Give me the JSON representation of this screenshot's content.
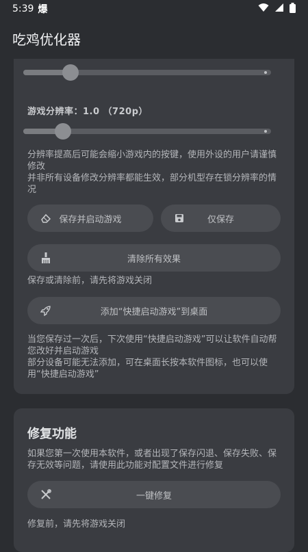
{
  "status_bar": {
    "time": "5:39",
    "notif_glyph": "爆",
    "icons": [
      "wifi-icon",
      "signal-icon",
      "battery-icon"
    ]
  },
  "app_bar": {
    "title": "吃鸡优化器"
  },
  "settings": {
    "slider1_level": 0.19,
    "resolution_label": "游戏分辨率：1.0 （720p）",
    "slider2_level": 0.16,
    "resolution_note": "分辨率提高后可能会缩小游戏内的按键，使用外设的用户请谨慎修改\n并非所有设备修改分辨率都能生效，部分机型存在锁分辨率的情况",
    "save_and_launch_label": "保存并启动游戏",
    "save_only_label": "仅保存",
    "clear_all_label": "清除所有效果",
    "save_clear_note": "保存或清除前，请先将游戏关闭",
    "add_shortcut_label": "添加“快捷启动游戏”到桌面",
    "shortcut_note": "当您保存过一次后，下次使用“快捷启动游戏”可以让软件自动帮您改好并启动游戏\n部分设备可能无法添加，可在桌面长按本软件图标，也可以使用“快捷启动游戏”"
  },
  "repair": {
    "title": "修复功能",
    "desc": "如果您第一次使用本软件，或者出现了保存闪退、保存失败、保存无效等问题，请使用此功能对配置文件进行修复",
    "button_label": "一键修复",
    "note": "修复前，请先将游戏关闭"
  },
  "colors": {
    "background": "#2b2d31",
    "card": "#3a3c41",
    "button": "#4a4c51"
  }
}
